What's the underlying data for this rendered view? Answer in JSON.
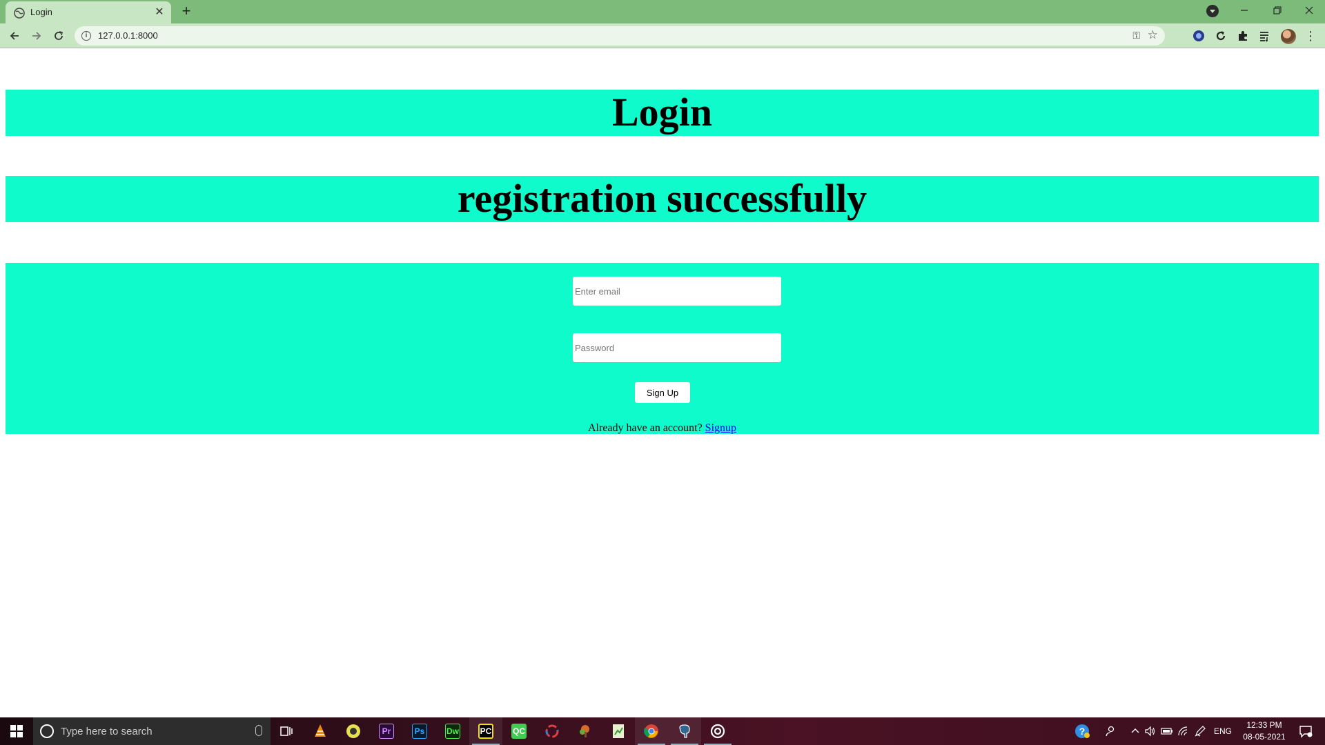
{
  "browser": {
    "tab_title": "Login",
    "tab_close": "✕",
    "new_tab": "+",
    "url": "127.0.0.1:8000"
  },
  "page": {
    "heading": "Login",
    "message": "registration successfully",
    "form": {
      "email_placeholder": "Enter email",
      "email_value": "",
      "password_placeholder": "Password",
      "password_value": "",
      "submit_label": "Sign Up",
      "footer_text": "Already have an account?",
      "footer_link": "Signup"
    }
  },
  "taskbar": {
    "search_placeholder": "Type here to search",
    "language": "ENG",
    "time": "12:33 PM",
    "date": "08-05-2021",
    "apps": [
      "task-view",
      "vlc",
      "app-yellow",
      "premiere-pro",
      "photoshop",
      "dreamweaver",
      "pycharm",
      "qt-creator",
      "app-ring",
      "app-tree",
      "app-green-doc",
      "chrome",
      "postgresql",
      "app-circle"
    ],
    "app_labels": {
      "premiere": "Pr",
      "photoshop": "Ps",
      "dreamweaver": "Dw",
      "pycharm": "PC",
      "qt": "QC"
    }
  },
  "colors": {
    "panel": "#10fbcb",
    "chrome_frame": "#7cbb7a",
    "chrome_toolbar": "#c9e6c4",
    "link": "#0000ee"
  }
}
